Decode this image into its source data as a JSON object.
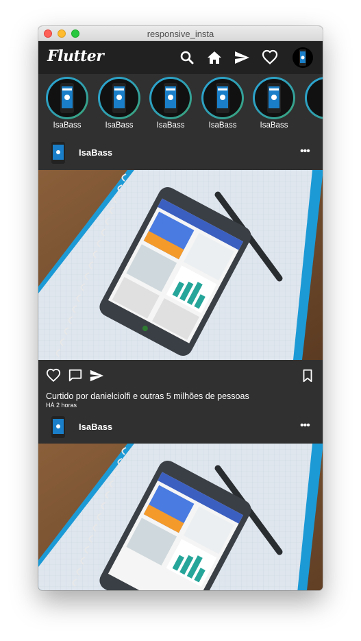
{
  "window": {
    "title": "responsive_insta"
  },
  "appbar": {
    "logo": "Flutter",
    "icons": [
      "search-icon",
      "home-icon",
      "send-icon",
      "heart-icon"
    ]
  },
  "stories": [
    {
      "name": "IsaBass"
    },
    {
      "name": "IsaBass"
    },
    {
      "name": "IsaBass"
    },
    {
      "name": "IsaBass"
    },
    {
      "name": "IsaBass"
    }
  ],
  "posts": [
    {
      "user": "IsaBass",
      "more": "•••",
      "likes_text": "Curtido por danielciolfi e outras 5 milhões de pessoas",
      "time_text": "HÀ 2 horas"
    },
    {
      "user": "IsaBass",
      "more": "•••"
    }
  ],
  "colors": {
    "background": "#303030",
    "appbar": "#212121",
    "ring_start": "#2ba6d8",
    "ring_end": "#3ba373",
    "text": "#ffffff"
  }
}
